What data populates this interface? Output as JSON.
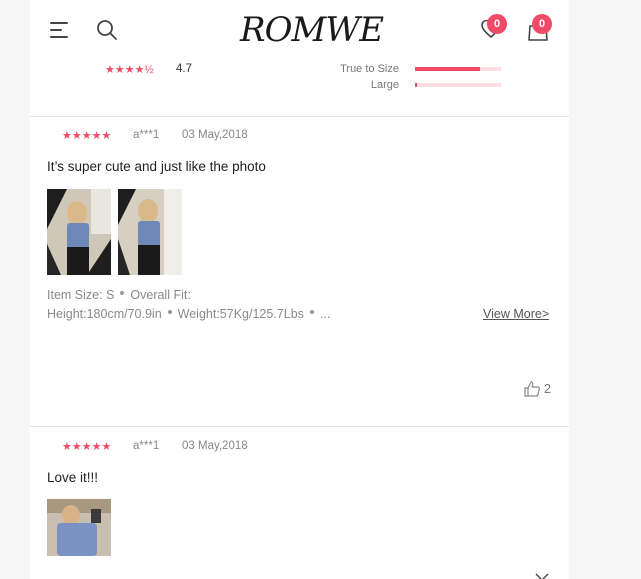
{
  "header": {
    "logo": "ROMWE",
    "wishlist_count": "0",
    "bag_count": "0"
  },
  "summary": {
    "stars": "★★★★½",
    "score": "4.7",
    "fit": [
      {
        "label": "True to Size",
        "share": 0.76
      },
      {
        "label": "Large",
        "share": 0.02
      }
    ]
  },
  "reviews": [
    {
      "stars": "★★★★★",
      "user": "a***1",
      "date": "03 May,2018",
      "text": "It’s super cute and just like the photo",
      "item_size": "Item Size: S",
      "overall_fit": "Overall Fit:",
      "height": "Height:180cm/70.9in",
      "weight": "Weight:57Kg/125.7Lbs",
      "ellipsis": "...",
      "view_more": "View More>",
      "likes": "2"
    },
    {
      "stars": "★★★★★",
      "user": "a***1",
      "date": "03 May,2018",
      "text": "Love it!!!"
    }
  ],
  "colors": {
    "accent": "#ef4a66",
    "divider": "#e3e3e3",
    "muted": "#888888"
  },
  "icons": [
    "menu-icon",
    "search-icon",
    "wishlist-icon",
    "bag-icon",
    "thumbs-up-icon",
    "chevron-down-icon"
  ]
}
